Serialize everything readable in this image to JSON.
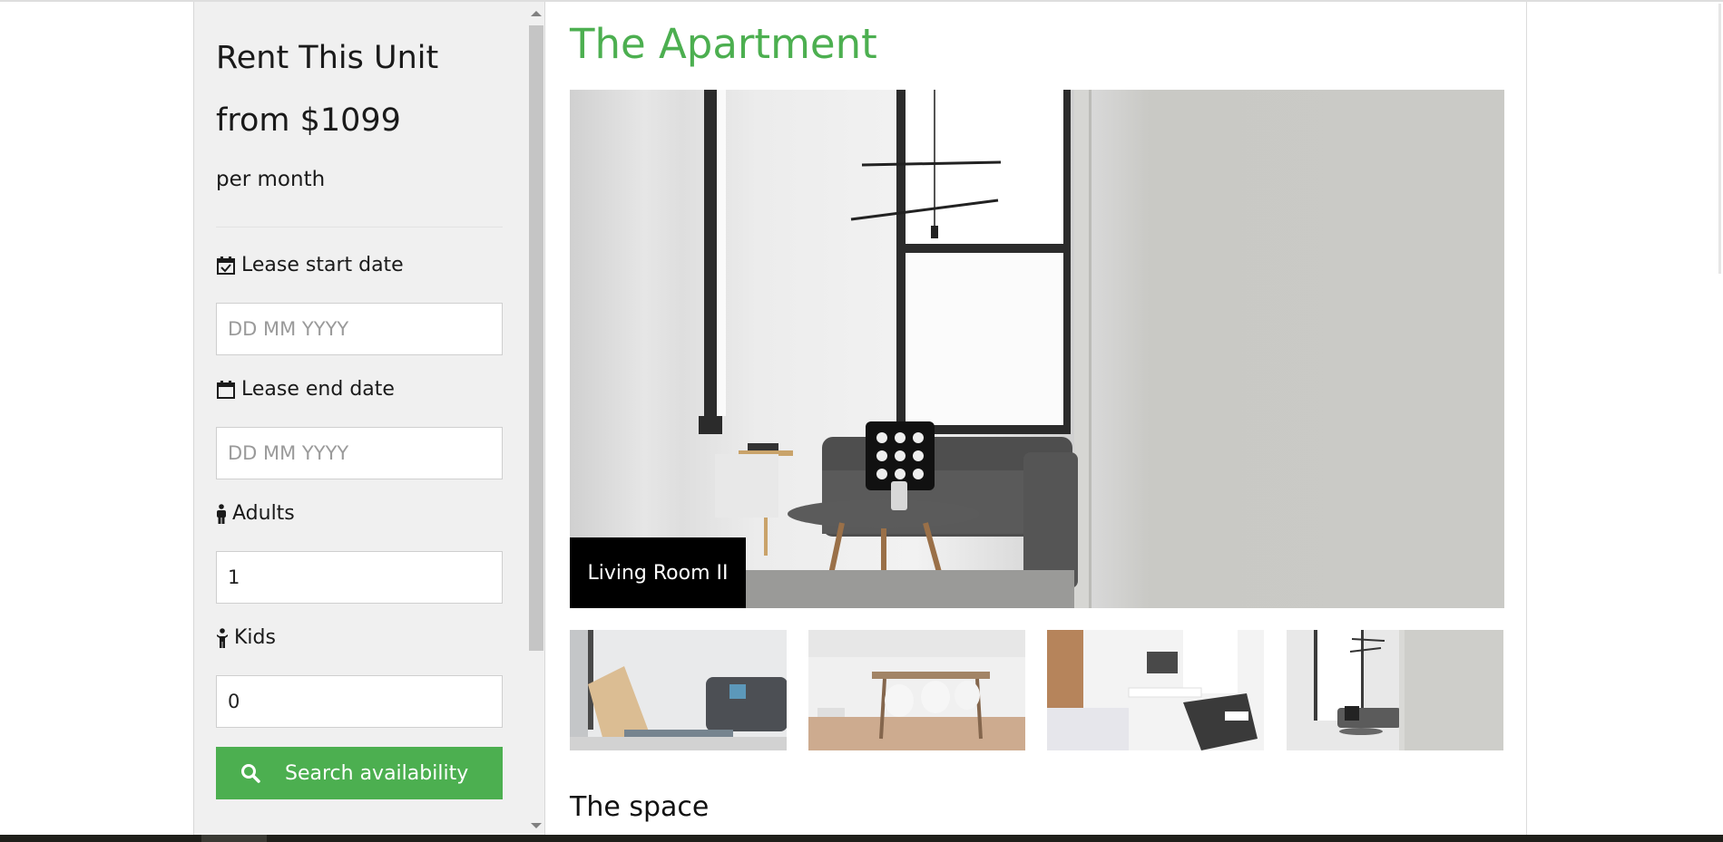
{
  "sidebar": {
    "title": "Rent This Unit",
    "price": "from $1099",
    "period": "per month",
    "fields": {
      "lease_start": {
        "label": "Lease start date",
        "placeholder": "DD MM YYYY",
        "value": ""
      },
      "lease_end": {
        "label": "Lease end date",
        "placeholder": "DD MM YYYY",
        "value": ""
      },
      "adults": {
        "label": "Adults",
        "value": "1"
      },
      "kids": {
        "label": "Kids",
        "value": "0"
      }
    },
    "search_button": {
      "label": "Search availability",
      "icon": "search-icon"
    }
  },
  "main": {
    "title": "The Apartment",
    "gallery": {
      "caption": "Living Room II",
      "thumbnails": [
        "thumbnail-living-room",
        "thumbnail-dining-room",
        "thumbnail-bedroom",
        "thumbnail-living-room-ii"
      ]
    },
    "section_title": "The space"
  },
  "colors": {
    "accent": "#4caf50",
    "sidebar_bg": "#f0f0f0",
    "caption_bg": "#000000"
  }
}
